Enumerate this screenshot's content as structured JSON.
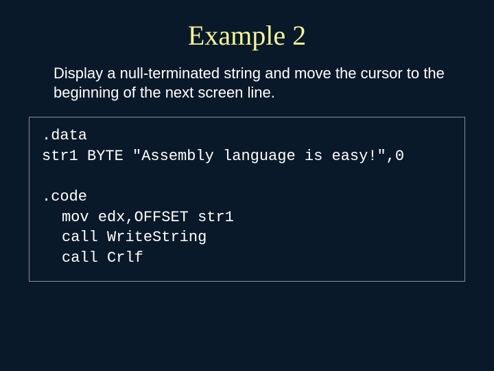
{
  "title": "Example 2",
  "description": "Display a null-terminated string and move the cursor to the beginning of the next screen line.",
  "code": {
    "l1": ".data",
    "l2": "str1 BYTE \"Assembly language is easy!\",0",
    "l3": ".code",
    "l4": "mov edx,OFFSET str1",
    "l5": "call WriteString",
    "l6": "call Crlf"
  }
}
